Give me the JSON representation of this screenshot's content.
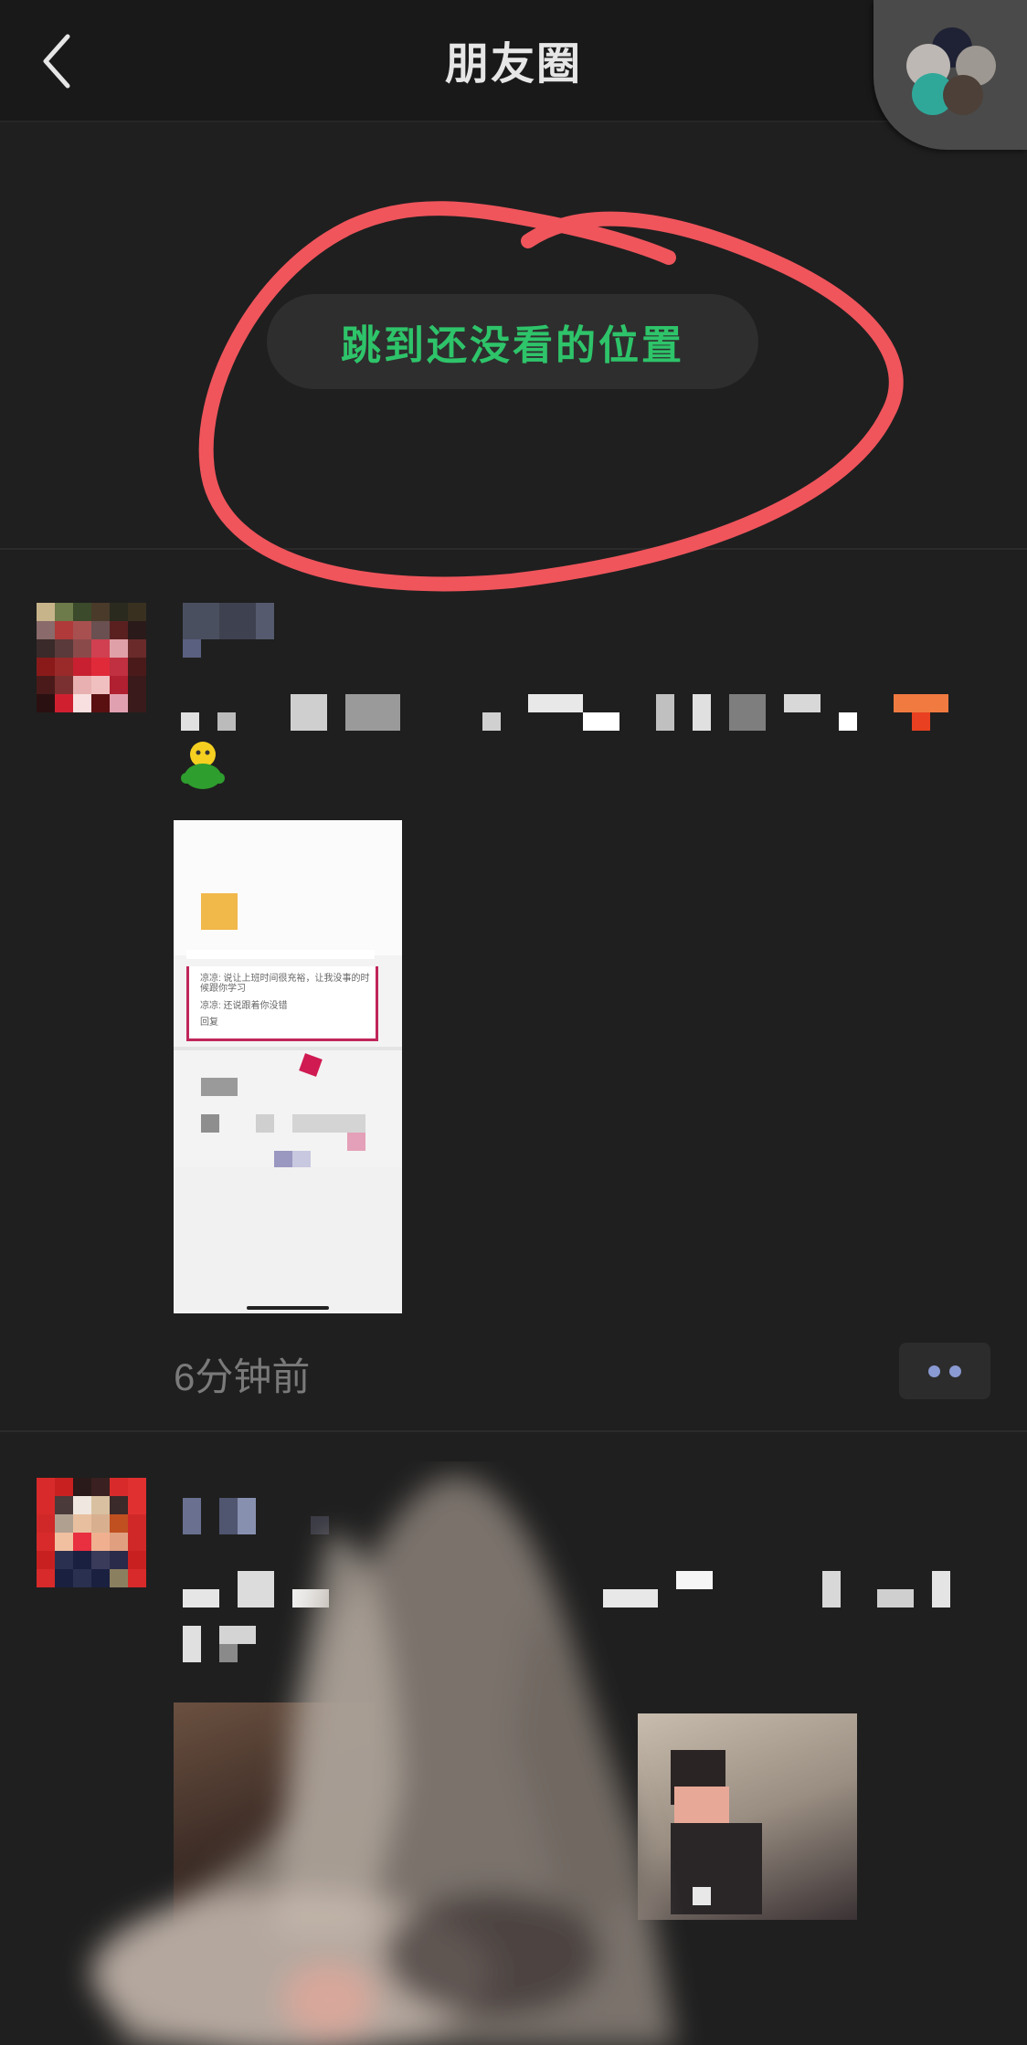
{
  "header": {
    "title": "朋友圈"
  },
  "jump_button": {
    "label": "跳到还没看的位置"
  },
  "posts": [
    {
      "screenshot_lines": [
        "凉凉: 说让上班时间很充裕，让我没事的时候跟你学习",
        "凉凉: 还说跟着你没错",
        "回复"
      ],
      "time": "6分钟前"
    }
  ],
  "colors": {
    "background": "#1f1f1f",
    "topbar": "#191919",
    "accent_green": "#2ec46a",
    "annotation_red": "#f0555c",
    "secondary_text": "#7a7a7a"
  },
  "icons": {
    "back": "chevron-left-icon",
    "more": "more-dots-icon",
    "floating": "floating-window-icon"
  }
}
